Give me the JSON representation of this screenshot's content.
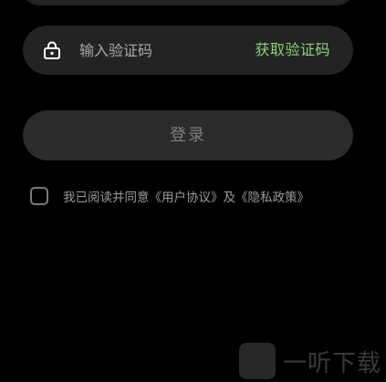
{
  "code_field": {
    "placeholder": "输入验证码",
    "value": "",
    "icon": "lock-icon",
    "get_code_label": "获取验证码",
    "accent_color": "#8bd27a"
  },
  "login": {
    "label": "登录"
  },
  "agreement": {
    "checked": false,
    "prefix": "我已阅读并同意",
    "user_agreement": "《用户协议》",
    "conjunction": "及",
    "privacy_policy": "《隐私政策》"
  },
  "watermark": {
    "text": "一听下载"
  }
}
